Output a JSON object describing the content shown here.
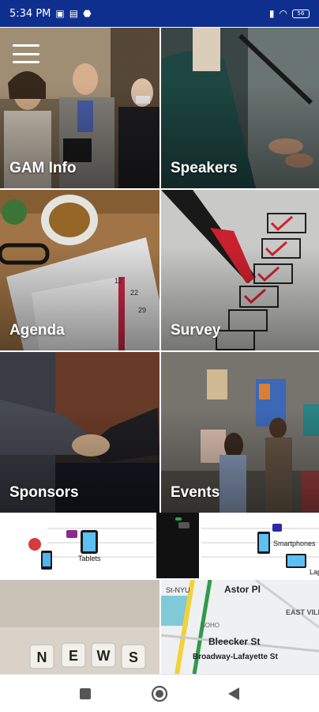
{
  "status_bar": {
    "time": "5:34 PM",
    "battery_level": "56"
  },
  "menu": {
    "icon": "hamburger-menu-icon"
  },
  "tiles": [
    {
      "label": "GAM Info"
    },
    {
      "label": "Speakers"
    },
    {
      "label": "Agenda"
    },
    {
      "label": "Survey"
    },
    {
      "label": "Sponsors"
    },
    {
      "label": "Events"
    }
  ],
  "banner": {
    "labels": [
      "Tablets",
      "Smartphones",
      "Lap"
    ]
  },
  "bottom_tiles": {
    "news_letters": [
      "N",
      "E",
      "W",
      "S"
    ],
    "map_labels": [
      "Astor Pl",
      "Bleecker St",
      "EAST VILLAGE",
      "NOHO",
      "Broadway-Lafayette St",
      "St-NYU"
    ]
  },
  "nav": {
    "square_icon": "recent-apps-square-icon",
    "circle_icon": "home-circle-icon",
    "back_icon": "back-triangle-icon"
  }
}
